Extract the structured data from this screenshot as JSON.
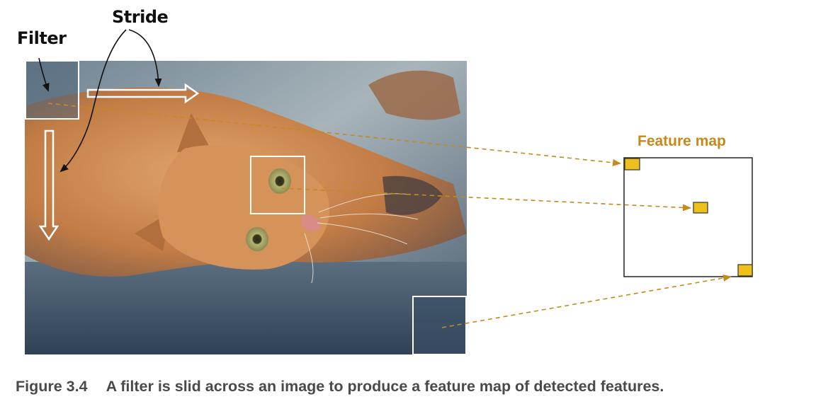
{
  "labels": {
    "filter": "Filter",
    "stride": "Stride",
    "feature_map": "Feature map"
  },
  "caption": {
    "number": "Figure 3.4",
    "text": "A filter is slid across an image to produce a feature map of detected features."
  },
  "colors": {
    "accent": "#c48a1b",
    "feature_cell": "#eec01c",
    "caption_text": "#4a4a4a",
    "photo_bg": "#5f7384"
  }
}
